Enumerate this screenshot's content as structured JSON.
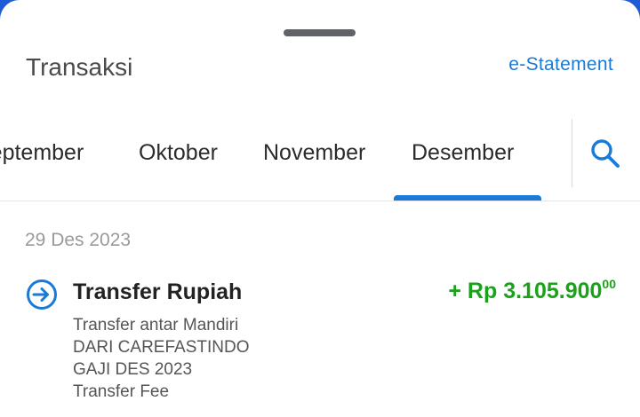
{
  "header": {
    "title": "Transaksi",
    "estatement_label": "e-Statement"
  },
  "tabs": [
    {
      "label": "September",
      "active": false
    },
    {
      "label": "Oktober",
      "active": false
    },
    {
      "label": "November",
      "active": false
    },
    {
      "label": "Desember",
      "active": true
    }
  ],
  "icons": {
    "search": "search-icon",
    "transfer": "transfer-in-icon"
  },
  "transactions": [
    {
      "date": "29 Des 2023",
      "title": "Transfer Rupiah",
      "amount_prefix": "+ Rp 3.105.900",
      "amount_cents": "00",
      "details": [
        "Transfer antar Mandiri",
        "DARI CAREFASTINDO",
        "GAJI DES 2023",
        "Transfer Fee"
      ]
    }
  ],
  "colors": {
    "accent": "#1a7ad6",
    "credit": "#1aa31a",
    "backdrop": "#1f5bd6"
  }
}
